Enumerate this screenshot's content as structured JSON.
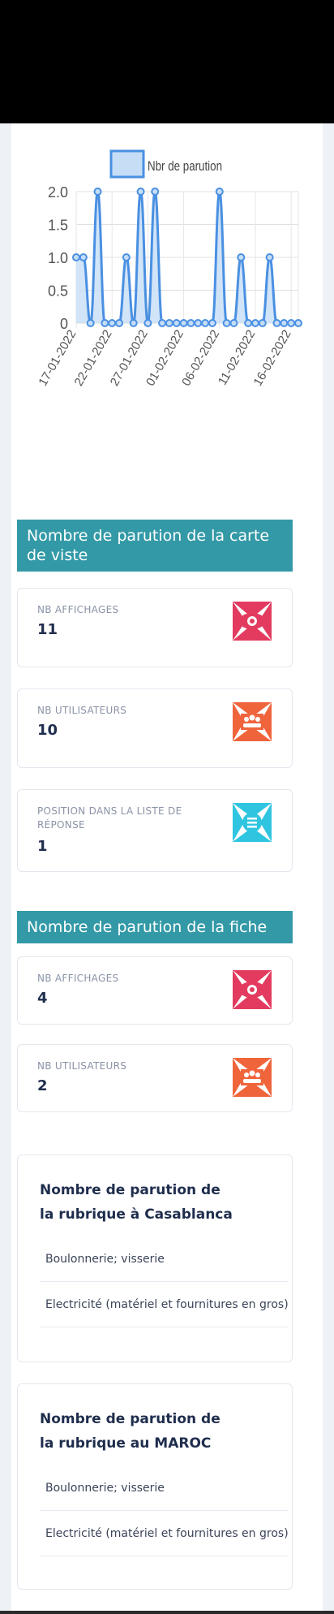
{
  "chart_data": {
    "type": "line",
    "legend": "Nbr de parution",
    "legend_position": "top",
    "series_color": "#4a90e2",
    "fill_color": "#c6ddf6",
    "ylim": [
      0,
      2.0
    ],
    "y_ticks": [
      "0",
      "0.5",
      "1.0",
      "1.5",
      "2.0"
    ],
    "x_tick_labels": [
      "17-01-2022",
      "22-01-2022",
      "27-01-2022",
      "01-02-2022",
      "06-02-2022",
      "11-02-2022",
      "16-02-2022"
    ],
    "x": [
      "17-01-2022",
      "18-01-2022",
      "19-01-2022",
      "20-01-2022",
      "21-01-2022",
      "22-01-2022",
      "23-01-2022",
      "24-01-2022",
      "25-01-2022",
      "26-01-2022",
      "27-01-2022",
      "28-01-2022",
      "29-01-2022",
      "30-01-2022",
      "31-01-2022",
      "01-02-2022",
      "02-02-2022",
      "03-02-2022",
      "04-02-2022",
      "05-02-2022",
      "06-02-2022",
      "07-02-2022",
      "08-02-2022",
      "09-02-2022",
      "10-02-2022",
      "11-02-2022",
      "12-02-2022",
      "13-02-2022",
      "14-02-2022",
      "15-02-2022",
      "16-02-2022",
      "17-02-2022"
    ],
    "values": [
      1,
      1,
      0,
      2,
      0,
      0,
      0,
      1,
      0,
      2,
      0,
      2,
      0,
      0,
      0,
      0,
      0,
      0,
      0,
      0,
      2,
      0,
      0,
      1,
      0,
      0,
      0,
      1,
      0,
      0,
      0,
      0
    ],
    "grid": true
  },
  "carte": {
    "title": "Nombre de parution de la carte de viste",
    "stats": [
      {
        "label": "NB AFFICHAGES",
        "value": "11",
        "icon": "eye-icon",
        "color": "#e33b5f"
      },
      {
        "label": "NB UTILISATEURS",
        "value": "10",
        "icon": "users-icon",
        "color": "#f0643c"
      },
      {
        "label": "POSITION DANS LA LISTE DE RÉPONSE",
        "value": "1",
        "icon": "list-icon",
        "color": "#2fc5e0"
      }
    ]
  },
  "fiche": {
    "title": "Nombre de parution de la fiche",
    "stats": [
      {
        "label": "NB AFFICHAGES",
        "value": "4",
        "icon": "eye-icon",
        "color": "#e33b5f"
      },
      {
        "label": "NB UTILISATEURS",
        "value": "2",
        "icon": "users-icon",
        "color": "#f0643c"
      }
    ]
  },
  "rubrique_casablanca": {
    "title": "Nombre de parution de la rubrique à Casablanca",
    "items": [
      "Boulonnerie; visserie",
      "Electricité (matériel et fournitures en gros)"
    ]
  },
  "rubrique_maroc": {
    "title": "Nombre de parution de la rubrique au MAROC",
    "items": [
      "Boulonnerie; visserie",
      "Electricité (matériel et fournitures en gros)"
    ]
  }
}
